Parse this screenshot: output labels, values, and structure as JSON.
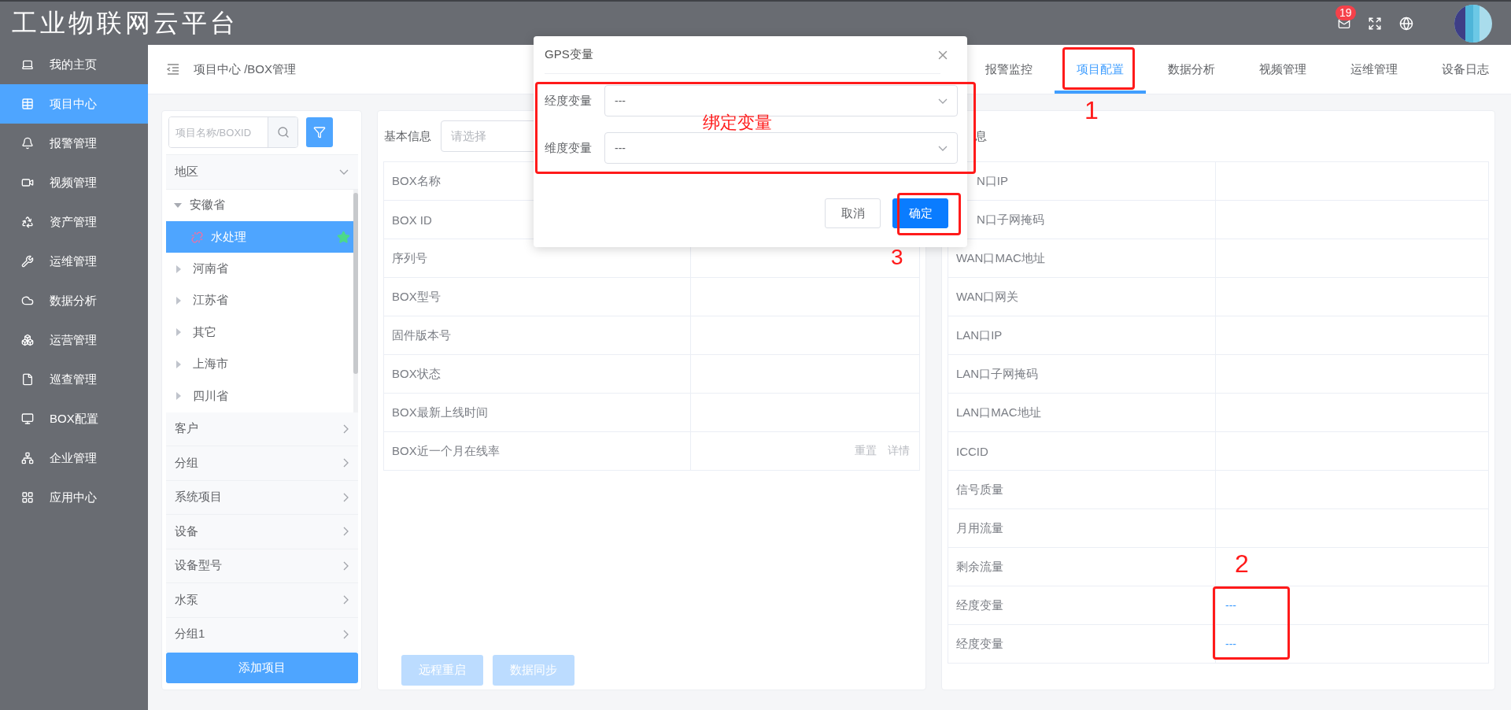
{
  "app_title": "工业物联网云平台",
  "header": {
    "badge": "19"
  },
  "sidebar": {
    "items": [
      {
        "label": "我的主页",
        "selected": false
      },
      {
        "label": "项目中心",
        "selected": true
      },
      {
        "label": "报警管理",
        "selected": false
      },
      {
        "label": "视频管理",
        "selected": false
      },
      {
        "label": "资产管理",
        "selected": false
      },
      {
        "label": "运维管理",
        "selected": false
      },
      {
        "label": "数据分析",
        "selected": false
      },
      {
        "label": "运营管理",
        "selected": false
      },
      {
        "label": "巡查管理",
        "selected": false
      },
      {
        "label": "BOX配置",
        "selected": false
      },
      {
        "label": "企业管理",
        "selected": false
      },
      {
        "label": "应用中心",
        "selected": false
      }
    ]
  },
  "breadcrumb": "项目中心 /BOX管理",
  "tabs": [
    {
      "label": "报警监控",
      "selected": false
    },
    {
      "label": "项目配置",
      "selected": true
    },
    {
      "label": "数据分析",
      "selected": false
    },
    {
      "label": "视频管理",
      "selected": false
    },
    {
      "label": "运维管理",
      "selected": false
    },
    {
      "label": "设备日志",
      "selected": false
    }
  ],
  "left_panel": {
    "search": {
      "placeholder": "项目名称/BOXID"
    },
    "sections": [
      {
        "label": "地区",
        "expanded": true,
        "tree": [
          {
            "label": "安徽省",
            "expanded": true,
            "selected": false,
            "children": [
              {
                "label": "水处理",
                "selected": true,
                "starred": true
              }
            ]
          },
          {
            "label": "河南省",
            "expanded": false,
            "selected": false
          },
          {
            "label": "江苏省",
            "expanded": false,
            "selected": false
          },
          {
            "label": "其它",
            "expanded": false,
            "selected": false
          },
          {
            "label": "上海市",
            "expanded": false,
            "selected": false
          },
          {
            "label": "四川省",
            "expanded": false,
            "selected": false
          }
        ]
      },
      {
        "label": "客户",
        "expanded": false
      },
      {
        "label": "分组",
        "expanded": false
      },
      {
        "label": "系统项目",
        "expanded": false
      },
      {
        "label": "设备",
        "expanded": false
      },
      {
        "label": "设备型号",
        "expanded": false
      },
      {
        "label": "水泵",
        "expanded": false
      },
      {
        "label": "分组1",
        "expanded": false
      }
    ],
    "add_button": "添加项目"
  },
  "basic_info": {
    "title": "基本信息",
    "select": {
      "placeholder": "请选择"
    },
    "rows": [
      {
        "label": "BOX名称"
      },
      {
        "label": "BOX ID"
      },
      {
        "label": "序列号"
      },
      {
        "label": "BOX型号"
      },
      {
        "label": "固件版本号"
      },
      {
        "label": "BOX状态"
      },
      {
        "label": "BOX最新上线时间"
      },
      {
        "label": "BOX近一个月在线率",
        "links": [
          "重置",
          "详情"
        ]
      }
    ],
    "buttons": [
      {
        "label": "远程重启",
        "disabled": true
      },
      {
        "label": "数据同步",
        "disabled": true
      }
    ]
  },
  "network_info": {
    "title": "息",
    "title_cut": true,
    "rows": [
      {
        "label": "N口IP",
        "cut": true
      },
      {
        "label": "N口子网掩码",
        "cut": true
      },
      {
        "label": "WAN口MAC地址",
        "cut": false
      },
      {
        "label": "WAN口网关",
        "cut": false
      },
      {
        "label": "LAN口IP",
        "cut": false
      },
      {
        "label": "LAN口子网掩码",
        "cut": false
      },
      {
        "label": "LAN口MAC地址",
        "cut": false
      },
      {
        "label": "ICCID",
        "cut": false
      },
      {
        "label": "信号质量",
        "cut": false
      },
      {
        "label": "月用流量",
        "cut": false
      },
      {
        "label": "剩余流量",
        "cut": false
      },
      {
        "label": "经度变量",
        "cut": false,
        "value": "---"
      },
      {
        "label": "经度变量",
        "cut": false,
        "value": "---"
      }
    ]
  },
  "dialog": {
    "title": "GPS变量",
    "fields": [
      {
        "label": "经度变量",
        "value": "---"
      },
      {
        "label": "维度变量",
        "value": "---"
      }
    ],
    "buttons": [
      {
        "label": "取消",
        "kind": "default"
      },
      {
        "label": "确定",
        "kind": "primary"
      }
    ]
  },
  "annotations": [
    {
      "text": "1"
    },
    {
      "text": "绑定变量"
    },
    {
      "text": "3"
    },
    {
      "text": "2"
    }
  ]
}
